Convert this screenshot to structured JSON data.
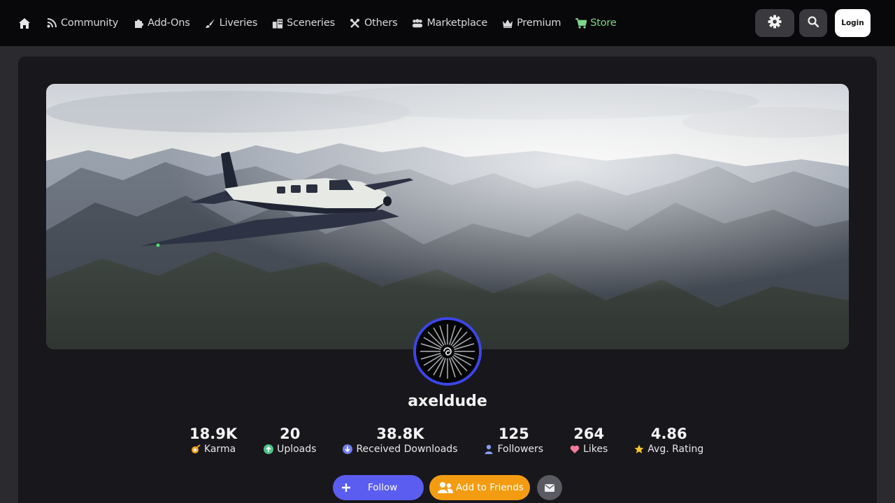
{
  "nav": {
    "home_icon": "home-icon",
    "items": [
      {
        "label": "Community",
        "icon": "rss-icon"
      },
      {
        "label": "Add-Ons",
        "icon": "puzzle-icon"
      },
      {
        "label": "Liveries",
        "icon": "brush-icon"
      },
      {
        "label": "Sceneries",
        "icon": "buildings-icon"
      },
      {
        "label": "Others",
        "icon": "tools-icon"
      },
      {
        "label": "Marketplace",
        "icon": "people-icon"
      },
      {
        "label": "Premium",
        "icon": "crown-icon"
      },
      {
        "label": "Store",
        "icon": "cart-icon",
        "color": "#7fd686"
      }
    ],
    "login_label": "Login"
  },
  "profile": {
    "username": "axeldude",
    "stats": [
      {
        "value": "18.9K",
        "label": "Karma",
        "icon": "karma-icon",
        "color": "#f5a623"
      },
      {
        "value": "20",
        "label": "Uploads",
        "icon": "upload-icon",
        "color": "#4cc38a"
      },
      {
        "value": "38.8K",
        "label": "Received Downloads",
        "icon": "download-icon",
        "color": "#6f7ef5"
      },
      {
        "value": "125",
        "label": "Followers",
        "icon": "user-icon",
        "color": "#8a9cf7"
      },
      {
        "value": "264",
        "label": "Likes",
        "icon": "heart-icon",
        "color": "#f27b9b"
      },
      {
        "value": "4.86",
        "label": "Avg. Rating",
        "icon": "star-icon",
        "color": "#f7c531"
      }
    ],
    "actions": {
      "follow_label": "Follow",
      "friends_label": "Add to Friends"
    }
  },
  "colors": {
    "accent": "#5b5df0",
    "friends": "#f39c12",
    "avatar_ring": "#3b46e8"
  }
}
